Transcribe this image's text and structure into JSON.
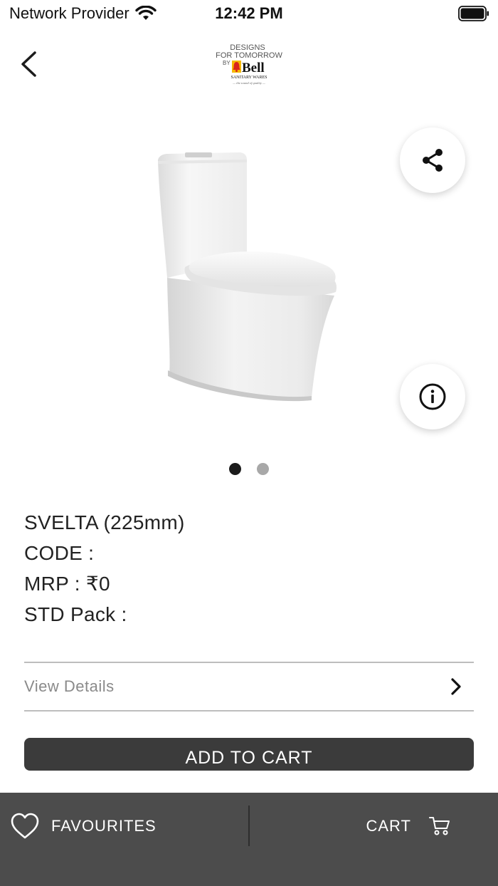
{
  "status_bar": {
    "carrier": "Network Provider",
    "time": "12:42 PM"
  },
  "header": {
    "logo": {
      "line1": "DESIGNS",
      "line2": "FOR TOMORROW",
      "line3": "BY",
      "brand": "Bell",
      "subline": "SANITARY WARES",
      "tagline": "— the sound of quality —"
    }
  },
  "product": {
    "name": "SVELTA (225mm)",
    "code_label": "CODE :",
    "mrp_label": "MRP : ₹0",
    "std_pack_label": "STD Pack :"
  },
  "carousel": {
    "total": 2,
    "active_index": 0
  },
  "actions": {
    "view_details": "View Details",
    "add_to_cart": "ADD TO CART"
  },
  "bottom_bar": {
    "favourites": "FAVOURITES",
    "cart": "CART"
  },
  "colors": {
    "bottom_bar_bg": "#4c4c4c",
    "button_bg": "#3b3b3b",
    "brand_red": "#d9241c",
    "brand_yellow": "#f5b800"
  }
}
